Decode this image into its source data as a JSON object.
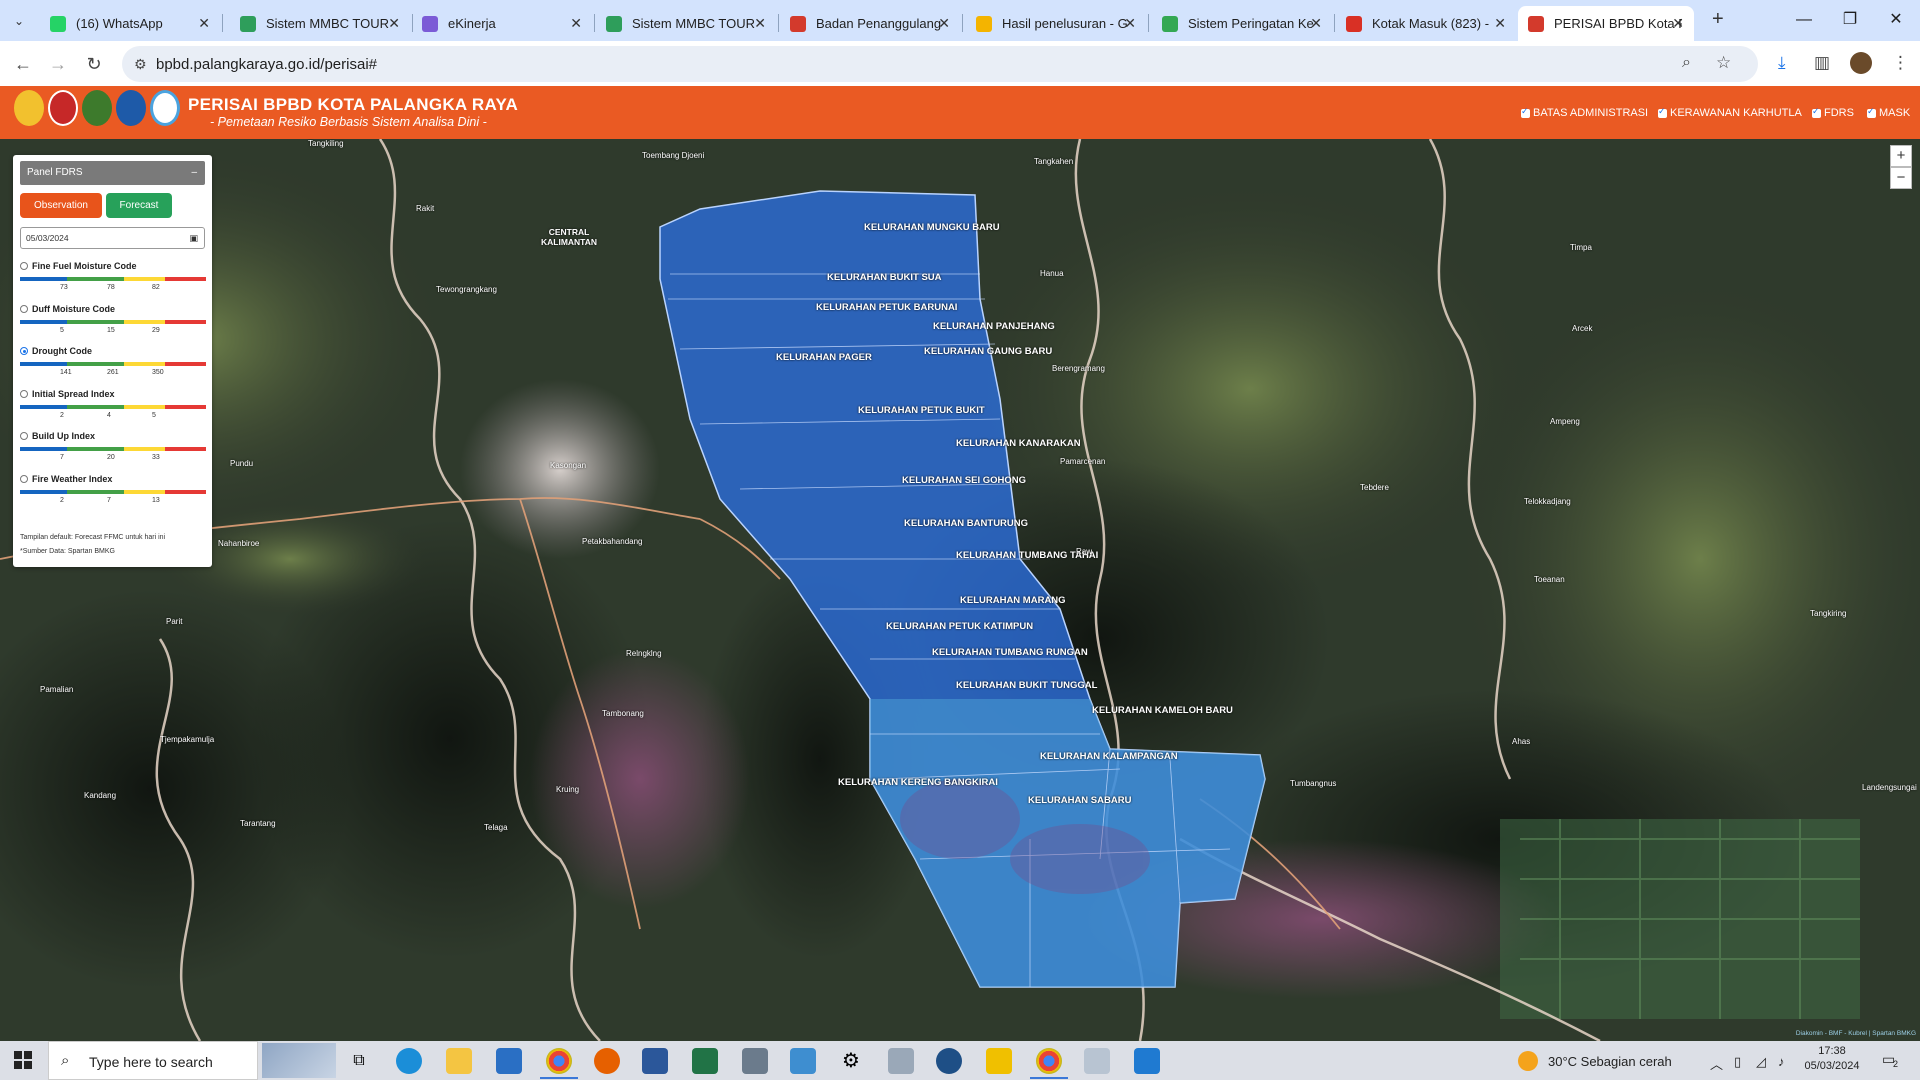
{
  "browser": {
    "tabs": [
      {
        "title": "(16) WhatsApp",
        "color": "#25d366"
      },
      {
        "title": "Sistem MMBC TOUR",
        "color": "#2e9e5b"
      },
      {
        "title": "eKinerja",
        "color": "#7b5bd6"
      },
      {
        "title": "Sistem MMBC TOUR",
        "color": "#2e9e5b"
      },
      {
        "title": "Badan Penanggulang",
        "color": "#d33a2c"
      },
      {
        "title": "Hasil penelusuran - G",
        "color": "#f4b400"
      },
      {
        "title": "Sistem Peringatan Ke",
        "color": "#34a853"
      },
      {
        "title": "Kotak Masuk (823) - ",
        "color": "#d93025"
      },
      {
        "title": "PERISAI BPBD Kota P",
        "color": "#d33a2c"
      }
    ],
    "new_tab_symbol": "+",
    "url": "bpbd.palangkaraya.go.id/perisai#"
  },
  "header": {
    "title": "PERISAI BPBD KOTA PALANGKA RAYA",
    "subtitle": "- Pemetaan Resiko Berbasis Sistem Analisa Dini -",
    "layers": [
      "BATAS ADMINISTRASI",
      "KERAWANAN KARHUTLA",
      "FDRS",
      "MASK"
    ]
  },
  "panel": {
    "title": "Panel FDRS",
    "minimize": "–",
    "observation_label": "Observation",
    "forecast_label": "Forecast",
    "date_value": "05/03/2024",
    "indices": [
      {
        "name": "Fine Fuel Moisture Code",
        "ticks": [
          "73",
          "78",
          "82"
        ],
        "selected": false
      },
      {
        "name": "Duff Moisture Code",
        "ticks": [
          "5",
          "15",
          "29"
        ],
        "selected": false
      },
      {
        "name": "Drought Code",
        "ticks": [
          "141",
          "261",
          "350"
        ],
        "selected": true
      },
      {
        "name": "Initial Spread Index",
        "ticks": [
          "2",
          "4",
          "5"
        ],
        "selected": false
      },
      {
        "name": "Build Up Index",
        "ticks": [
          "7",
          "20",
          "33"
        ],
        "selected": false
      },
      {
        "name": "Fire Weather Index",
        "ticks": [
          "2",
          "7",
          "13"
        ],
        "selected": false
      }
    ],
    "note1": "Tampilan default: Forecast FFMC untuk hari ini",
    "note2": "*Sumber Data: Spartan BMKG",
    "scale_colors": [
      "#1565c0",
      "#43a047",
      "#fdd835",
      "#e53935"
    ]
  },
  "map": {
    "kelurahan": [
      "KELURAHAN MUNGKU BARU",
      "KELURAHAN BUKIT SUA",
      "KELURAHAN PETUK BARUNAI",
      "KELURAHAN PANJEHANG",
      "KELURAHAN GAUNG BARU",
      "KELURAHAN PAGER",
      "KELURAHAN PETUK BUKIT",
      "KELURAHAN KANARAKAN",
      "KELURAHAN SEI GOHONG",
      "KELURAHAN BANTURUNG",
      "KELURAHAN TUMBANG TAHAI",
      "KELURAHAN MARANG",
      "KELURAHAN PETUK KATIMPUN",
      "KELURAHAN TUMBANG RUNGAN",
      "KELURAHAN BUKIT TUNGGAL",
      "KELURAHAN KAMELOH BARU",
      "KELURAHAN KALAMPANGAN",
      "KELURAHAN KERENG BANGKIRAI",
      "KELURAHAN SABARU"
    ],
    "places": [
      "Tangkiling",
      "Toembang Djoeni",
      "CENTRAL KALIMANTAN",
      "Rakit",
      "Tewongrangkang",
      "Tangkahen",
      "Hanua",
      "Timpa",
      "Arcek",
      "Berengramang",
      "Ampeng",
      "Pamarcenan",
      "Tebdere",
      "Telokkadjang",
      "Raw",
      "Toeanan",
      "Tangkiring",
      "Kasongan",
      "Pundu",
      "Petakbahandang",
      "Nahanbiroe",
      "Parit",
      "Pamalian",
      "Tjempakamulja",
      "Kandang",
      "Tarantang",
      "Telaga",
      "Kruing",
      "Tambonang",
      "Relngklng",
      "Tumbangnus",
      "Ahas",
      "Landengsungai"
    ],
    "zoom_in": "+",
    "zoom_out": "−",
    "attribution": "Diakomin - BMF - Kubrel | Spartan BMKG"
  },
  "taskbar": {
    "search_placeholder": "Type here to search",
    "weather": "30°C  Sebagian cerah",
    "time": "17:38",
    "date": "05/03/2024",
    "notif_count": "2"
  }
}
